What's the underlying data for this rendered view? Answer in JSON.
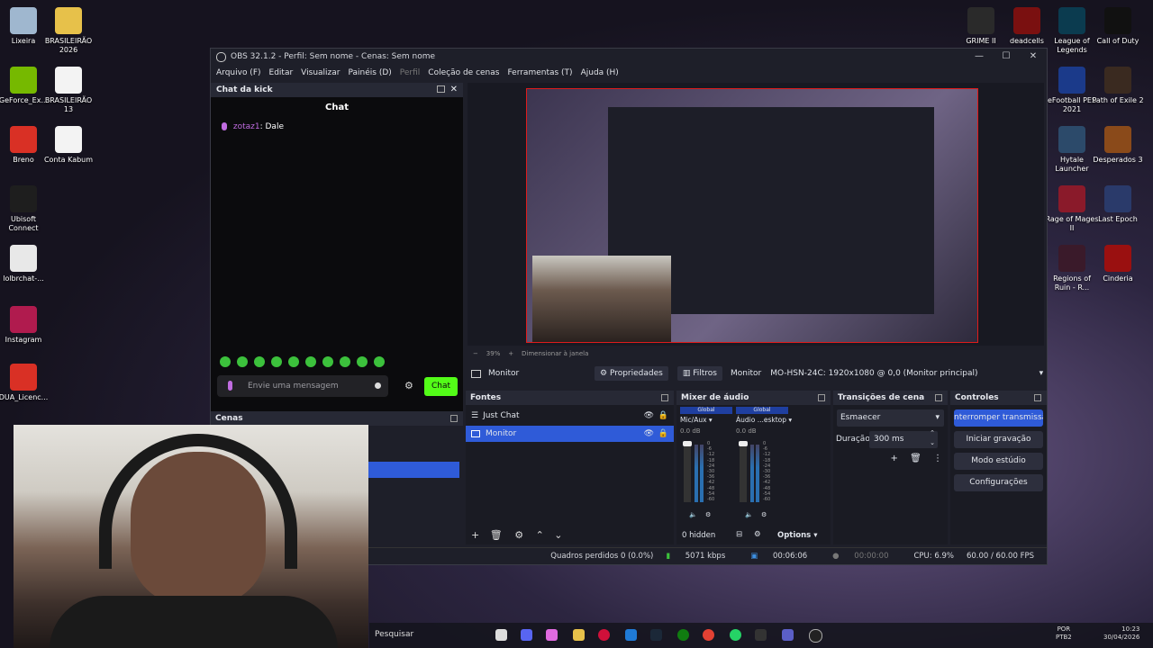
{
  "desktop_left": [
    {
      "label": "Lixeira",
      "color": "#9fb7cf"
    },
    {
      "label": "BRASILEIRÃO 2026",
      "color": "#e7c14a"
    },
    {
      "label": "GeForce_Ex...",
      "color": "#76b900"
    },
    {
      "label": "BRASILEIRÃO 13",
      "color": "#f3f3f3"
    },
    {
      "label": "Breno",
      "color": "#d93025"
    },
    {
      "label": "Conta Kabum",
      "color": "#f3f3f3"
    },
    {
      "label": "Ubisoft Connect",
      "color": "#1e1e1e"
    },
    {
      "label": "lolbrchat-...",
      "color": "#e8e8e8"
    },
    {
      "label": "Instagram",
      "color": "#b01b4e"
    },
    {
      "label": "DUA_Licenc...",
      "color": "#d93025"
    }
  ],
  "desktop_right": [
    {
      "label": "GRIME II",
      "color": "#2a2a2a"
    },
    {
      "label": "deadcells",
      "color": "#7a1010"
    },
    {
      "label": "League of Legends",
      "color": "#0b3b4f"
    },
    {
      "label": "Call of Duty",
      "color": "#111"
    },
    {
      "label": "eFootball PES 2021",
      "color": "#1b3a8a"
    },
    {
      "label": "Path of Exile 2",
      "color": "#3a2a20"
    },
    {
      "label": "Hytale Launcher",
      "color": "#2c4a6a"
    },
    {
      "label": "Desperados 3",
      "color": "#8a4a1a"
    },
    {
      "label": "Rage of Mages II",
      "color": "#8a1a2a"
    },
    {
      "label": "Last Epoch",
      "color": "#2a3a6a"
    },
    {
      "label": "Regions of Ruin - R...",
      "color": "#3a1a2a"
    },
    {
      "label": "Cinderia",
      "color": "#9a1010"
    }
  ],
  "window": {
    "title": "OBS 32.1.2 - Perfil: Sem nome - Cenas: Sem nome",
    "minimize": "—",
    "maximize": "☐",
    "close": "✕"
  },
  "menu": [
    "Arquivo (F)",
    "Editar",
    "Visualizar",
    "Painéis (D)",
    "Perfil",
    "Coleção de cenas",
    "Ferramentas (T)",
    "Ajuda (H)"
  ],
  "chat_dock": {
    "title": "Chat da kick",
    "header": "Chat",
    "message_user": "zotaz1",
    "message_text": ": Dale",
    "input_placeholder": "Envie uma mensagem",
    "send_label": "Chat"
  },
  "scenes_dock": {
    "title": "Cenas"
  },
  "preview": {
    "zoom": "39%",
    "zoom_label": "Dimensionar à janela"
  },
  "source_toolbar": {
    "source_name": "Monitor",
    "properties": "Propriedades",
    "filters": "Filtros",
    "display_label": "Monitor",
    "display_value": "MO-HSN-24C: 1920x1080 @ 0,0 (Monitor principal)"
  },
  "sources": {
    "title": "Fontes",
    "items": [
      {
        "label": "Just Chat"
      },
      {
        "label": "Monitor"
      }
    ]
  },
  "mixer": {
    "title": "Mixer de áudio",
    "channels": [
      {
        "badge": "Global",
        "name": "Mic/Aux",
        "db": "0.0 dB"
      },
      {
        "badge": "Global",
        "name": "Áudio ...esktop",
        "db": "0.0 dB"
      }
    ],
    "hidden": "0 hidden",
    "options": "Options",
    "scale": [
      "0",
      "-6",
      "-12",
      "-18",
      "-24",
      "-30",
      "-36",
      "-42",
      "-48",
      "-54",
      "-60"
    ]
  },
  "transitions": {
    "title": "Transições de cena",
    "selected": "Esmaecer",
    "duration_label": "Duração",
    "duration_value": "300 ms"
  },
  "controls": {
    "title": "Controles",
    "stop_stream": "nterromper transmissã",
    "record": "Iniciar gravação",
    "studio": "Modo estúdio",
    "settings": "Configurações"
  },
  "status": {
    "dropped": "Quadros perdidos 0 (0.0%)",
    "bitrate": "5071 kbps",
    "stream_time": "00:06:06",
    "rec_time": "00:00:00",
    "cpu": "CPU: 6.9%",
    "fps": "60.00 / 60.00 FPS"
  },
  "taskbar": {
    "search": "Pesquisar",
    "lang": "POR",
    "layout": "PTB2",
    "time": "10:23",
    "date": "30/04/2026"
  },
  "colors": {
    "accent": "#2f5bd8",
    "kick_green": "#53fc18",
    "red_border": "#e01b1b"
  }
}
